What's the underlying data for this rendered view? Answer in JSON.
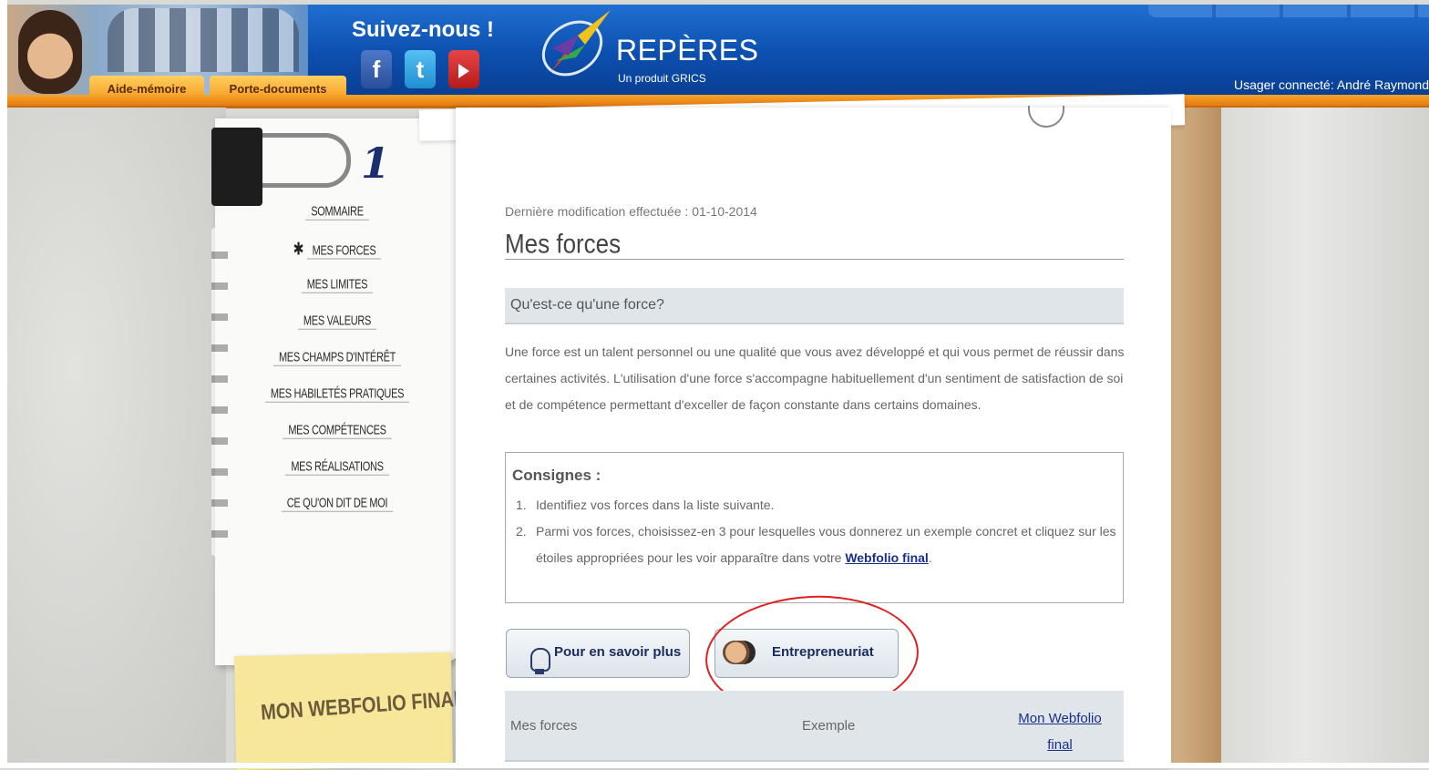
{
  "header": {
    "tabs": [
      "Aide-mémoire",
      "Porte-documents"
    ],
    "follow_label": "Suivez-nous !",
    "social": {
      "facebook": "f",
      "twitter": "t"
    },
    "logo_title": "REPÈRES",
    "logo_subtitle": "Un produit GRICS",
    "user_label": "Usager connecté: André Raymond"
  },
  "sidebar": {
    "badge": "1",
    "items": [
      {
        "label": "Sommaire",
        "active": false
      },
      {
        "label": "Mes forces",
        "active": true
      },
      {
        "label": "Mes limites",
        "active": false
      },
      {
        "label": "Mes valeurs",
        "active": false
      },
      {
        "label": "Mes champs d'intérêt",
        "active": false
      },
      {
        "label": "Mes habiletés pratiques",
        "active": false
      },
      {
        "label": "Mes compétences",
        "active": false
      },
      {
        "label": "Mes réalisations",
        "active": false
      },
      {
        "label": "Ce qu'on dit de moi",
        "active": false
      }
    ],
    "webfolio_label": "MON WEBFOLIO FINAL"
  },
  "main": {
    "last_modified": "Dernière modification effectuée : 01-10-2014",
    "title": "Mes forces",
    "question": "Qu'est-ce qu'une force?",
    "definition": "Une force est un talent personnel ou une qualité que vous avez développé et qui vous permet de réussir dans certaines activités. L'utilisation d'une force s'accompagne habituellement d'un sentiment de satisfaction de soi et de compétence permettant d'exceller de façon constante dans certains domaines.",
    "consignes_title": "Consignes :",
    "consignes": [
      {
        "num": "1.",
        "text": "Identifiez vos forces dans la liste suivante."
      },
      {
        "num": "2.",
        "text": "Parmi vos forces, choisissez-en 3 pour lesquelles vous donnerez un exemple concret et cliquez sur les étoiles appropriées pour les voir apparaître dans votre ",
        "link": "Webfolio final",
        "end": "."
      }
    ],
    "btn_more": "Pour en savoir plus",
    "btn_entrepreneuriat": "Entrepreneuriat",
    "table_headers": [
      "Mes forces",
      "Exemple",
      "Mon Webfolio final"
    ]
  },
  "colors": {
    "header_blue": "#0c4fae",
    "orange": "#f59a1f",
    "link": "#1a2f8a",
    "annotation_circle": "#e02020"
  }
}
